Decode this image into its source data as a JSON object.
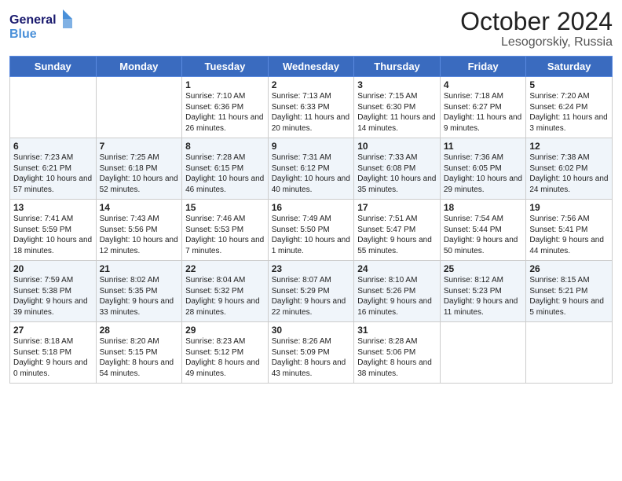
{
  "header": {
    "logo_line1": "General",
    "logo_line2": "Blue",
    "month": "October 2024",
    "location": "Lesogorskiy, Russia"
  },
  "days_of_week": [
    "Sunday",
    "Monday",
    "Tuesday",
    "Wednesday",
    "Thursday",
    "Friday",
    "Saturday"
  ],
  "weeks": [
    [
      {
        "num": "",
        "sunrise": "",
        "sunset": "",
        "daylight": ""
      },
      {
        "num": "",
        "sunrise": "",
        "sunset": "",
        "daylight": ""
      },
      {
        "num": "1",
        "sunrise": "Sunrise: 7:10 AM",
        "sunset": "Sunset: 6:36 PM",
        "daylight": "Daylight: 11 hours and 26 minutes."
      },
      {
        "num": "2",
        "sunrise": "Sunrise: 7:13 AM",
        "sunset": "Sunset: 6:33 PM",
        "daylight": "Daylight: 11 hours and 20 minutes."
      },
      {
        "num": "3",
        "sunrise": "Sunrise: 7:15 AM",
        "sunset": "Sunset: 6:30 PM",
        "daylight": "Daylight: 11 hours and 14 minutes."
      },
      {
        "num": "4",
        "sunrise": "Sunrise: 7:18 AM",
        "sunset": "Sunset: 6:27 PM",
        "daylight": "Daylight: 11 hours and 9 minutes."
      },
      {
        "num": "5",
        "sunrise": "Sunrise: 7:20 AM",
        "sunset": "Sunset: 6:24 PM",
        "daylight": "Daylight: 11 hours and 3 minutes."
      }
    ],
    [
      {
        "num": "6",
        "sunrise": "Sunrise: 7:23 AM",
        "sunset": "Sunset: 6:21 PM",
        "daylight": "Daylight: 10 hours and 57 minutes."
      },
      {
        "num": "7",
        "sunrise": "Sunrise: 7:25 AM",
        "sunset": "Sunset: 6:18 PM",
        "daylight": "Daylight: 10 hours and 52 minutes."
      },
      {
        "num": "8",
        "sunrise": "Sunrise: 7:28 AM",
        "sunset": "Sunset: 6:15 PM",
        "daylight": "Daylight: 10 hours and 46 minutes."
      },
      {
        "num": "9",
        "sunrise": "Sunrise: 7:31 AM",
        "sunset": "Sunset: 6:12 PM",
        "daylight": "Daylight: 10 hours and 40 minutes."
      },
      {
        "num": "10",
        "sunrise": "Sunrise: 7:33 AM",
        "sunset": "Sunset: 6:08 PM",
        "daylight": "Daylight: 10 hours and 35 minutes."
      },
      {
        "num": "11",
        "sunrise": "Sunrise: 7:36 AM",
        "sunset": "Sunset: 6:05 PM",
        "daylight": "Daylight: 10 hours and 29 minutes."
      },
      {
        "num": "12",
        "sunrise": "Sunrise: 7:38 AM",
        "sunset": "Sunset: 6:02 PM",
        "daylight": "Daylight: 10 hours and 24 minutes."
      }
    ],
    [
      {
        "num": "13",
        "sunrise": "Sunrise: 7:41 AM",
        "sunset": "Sunset: 5:59 PM",
        "daylight": "Daylight: 10 hours and 18 minutes."
      },
      {
        "num": "14",
        "sunrise": "Sunrise: 7:43 AM",
        "sunset": "Sunset: 5:56 PM",
        "daylight": "Daylight: 10 hours and 12 minutes."
      },
      {
        "num": "15",
        "sunrise": "Sunrise: 7:46 AM",
        "sunset": "Sunset: 5:53 PM",
        "daylight": "Daylight: 10 hours and 7 minutes."
      },
      {
        "num": "16",
        "sunrise": "Sunrise: 7:49 AM",
        "sunset": "Sunset: 5:50 PM",
        "daylight": "Daylight: 10 hours and 1 minute."
      },
      {
        "num": "17",
        "sunrise": "Sunrise: 7:51 AM",
        "sunset": "Sunset: 5:47 PM",
        "daylight": "Daylight: 9 hours and 55 minutes."
      },
      {
        "num": "18",
        "sunrise": "Sunrise: 7:54 AM",
        "sunset": "Sunset: 5:44 PM",
        "daylight": "Daylight: 9 hours and 50 minutes."
      },
      {
        "num": "19",
        "sunrise": "Sunrise: 7:56 AM",
        "sunset": "Sunset: 5:41 PM",
        "daylight": "Daylight: 9 hours and 44 minutes."
      }
    ],
    [
      {
        "num": "20",
        "sunrise": "Sunrise: 7:59 AM",
        "sunset": "Sunset: 5:38 PM",
        "daylight": "Daylight: 9 hours and 39 minutes."
      },
      {
        "num": "21",
        "sunrise": "Sunrise: 8:02 AM",
        "sunset": "Sunset: 5:35 PM",
        "daylight": "Daylight: 9 hours and 33 minutes."
      },
      {
        "num": "22",
        "sunrise": "Sunrise: 8:04 AM",
        "sunset": "Sunset: 5:32 PM",
        "daylight": "Daylight: 9 hours and 28 minutes."
      },
      {
        "num": "23",
        "sunrise": "Sunrise: 8:07 AM",
        "sunset": "Sunset: 5:29 PM",
        "daylight": "Daylight: 9 hours and 22 minutes."
      },
      {
        "num": "24",
        "sunrise": "Sunrise: 8:10 AM",
        "sunset": "Sunset: 5:26 PM",
        "daylight": "Daylight: 9 hours and 16 minutes."
      },
      {
        "num": "25",
        "sunrise": "Sunrise: 8:12 AM",
        "sunset": "Sunset: 5:23 PM",
        "daylight": "Daylight: 9 hours and 11 minutes."
      },
      {
        "num": "26",
        "sunrise": "Sunrise: 8:15 AM",
        "sunset": "Sunset: 5:21 PM",
        "daylight": "Daylight: 9 hours and 5 minutes."
      }
    ],
    [
      {
        "num": "27",
        "sunrise": "Sunrise: 8:18 AM",
        "sunset": "Sunset: 5:18 PM",
        "daylight": "Daylight: 9 hours and 0 minutes."
      },
      {
        "num": "28",
        "sunrise": "Sunrise: 8:20 AM",
        "sunset": "Sunset: 5:15 PM",
        "daylight": "Daylight: 8 hours and 54 minutes."
      },
      {
        "num": "29",
        "sunrise": "Sunrise: 8:23 AM",
        "sunset": "Sunset: 5:12 PM",
        "daylight": "Daylight: 8 hours and 49 minutes."
      },
      {
        "num": "30",
        "sunrise": "Sunrise: 8:26 AM",
        "sunset": "Sunset: 5:09 PM",
        "daylight": "Daylight: 8 hours and 43 minutes."
      },
      {
        "num": "31",
        "sunrise": "Sunrise: 8:28 AM",
        "sunset": "Sunset: 5:06 PM",
        "daylight": "Daylight: 8 hours and 38 minutes."
      },
      {
        "num": "",
        "sunrise": "",
        "sunset": "",
        "daylight": ""
      },
      {
        "num": "",
        "sunrise": "",
        "sunset": "",
        "daylight": ""
      }
    ]
  ]
}
